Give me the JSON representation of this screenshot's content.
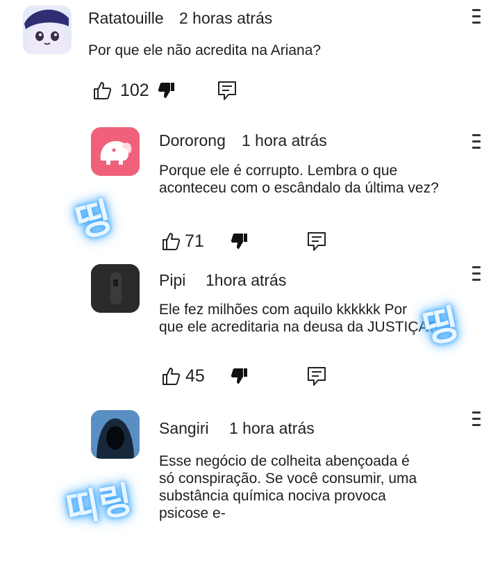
{
  "comments": [
    {
      "author": "Ratatouille",
      "time": "2 horas atrás",
      "text": [
        "Por que ele não acredita na Ariana?"
      ],
      "likes": "102"
    },
    {
      "author": "Dororong",
      "time": "1 hora atrás",
      "text": [
        "Porque ele é corrupto. Lembra o que",
        "aconteceu com o escândalo da última vez?"
      ],
      "likes": "71"
    },
    {
      "author": "Pipi",
      "time": "1hora atrás",
      "text": [
        "Ele fez milhões com aquilo kkkkkk Por",
        "que ele acreditaria na deusa da JUSTIÇA?"
      ],
      "likes": "45"
    },
    {
      "author": "Sangiri",
      "time": "1 hora atrás",
      "text": [
        "Esse negócio de colheita abençoada é",
        "só conspiração. Se você consumir, uma",
        "substância química nociva provoca",
        "psicose e-"
      ]
    }
  ],
  "sfx": [
    "띵",
    "띵",
    "띠링"
  ],
  "colors": {
    "sfx_glow": "#3ea7ff",
    "avatar_pink": "#f0607a",
    "avatar_dark": "#2b2b2b",
    "avatar_blue": "#4a7fb5"
  }
}
